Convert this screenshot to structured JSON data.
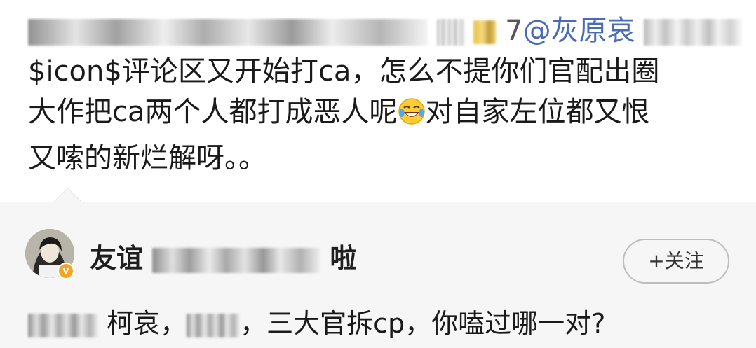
{
  "post": {
    "line1_suffix": "7",
    "mention": "@灰原哀",
    "line2": "$icon$评论区又开始打ca，怎么不提你们官配出圈",
    "line3_before_emoji": "大作把ca两个人都打成恶人呢",
    "emoji": "laughing-crying-emoji",
    "line3_after_emoji": "对自家左位都又恨",
    "line4": "又嗦的新烂解呀。。"
  },
  "comment": {
    "username_visible_tail": "啦",
    "username_visible_head": "友谊",
    "follow_label": "+关注",
    "text_part1": "柯哀，",
    "text_part2": "，三大官拆cp，你嗑过哪一对?"
  },
  "colors": {
    "mention": "#4a6bb5",
    "panel_background": "#f6f6f6",
    "verified_badge": "#f4a623"
  }
}
